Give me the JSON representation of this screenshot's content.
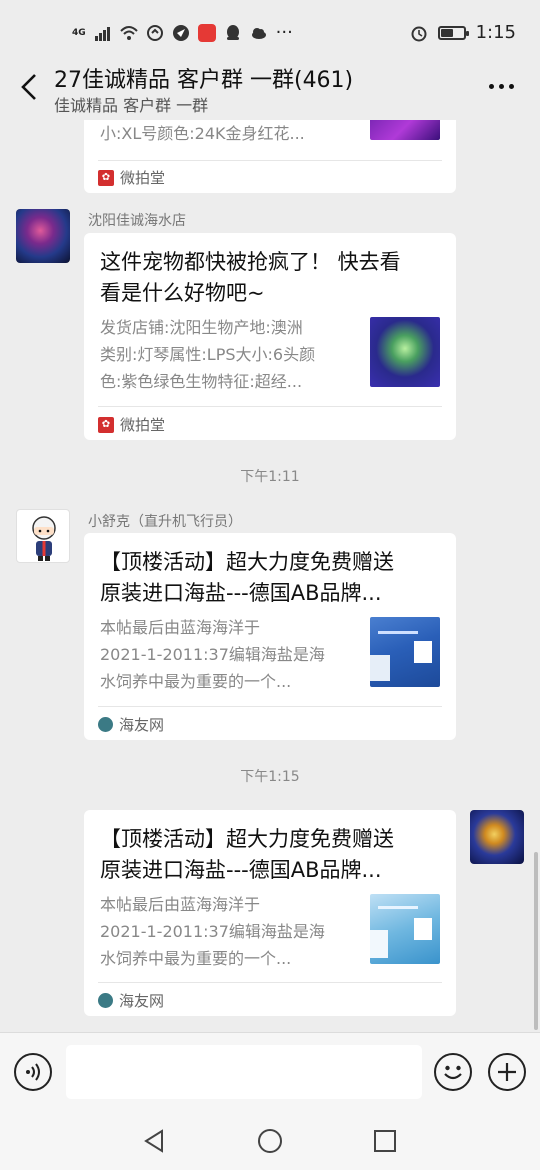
{
  "status_bar": {
    "network": "4G",
    "time": "1:15",
    "battery_level": 0.55
  },
  "header": {
    "title": "27佳诚精品 客户群 一群(461)",
    "subtitle": "佳诚精品 客户群 一群"
  },
  "messages": [
    {
      "type": "card",
      "direction": "in",
      "sender": "",
      "title": "",
      "desc_lines": [
        "小:XL号颜色:24K金身红花..."
      ],
      "source": "微拍堂"
    },
    {
      "type": "card",
      "direction": "in",
      "sender": "沈阳佳诚海水店",
      "title_lines": [
        "这件宠物都快被抢疯了！ 快去看",
        "看是什么好物吧~"
      ],
      "desc_lines": [
        "发货店铺:沈阳生物产地:澳洲",
        "类别:灯琴属性:LPS大小:6头颜",
        "色:紫色绿色生物特征:超经..."
      ],
      "source": "微拍堂"
    },
    {
      "type": "time",
      "text": "下午1:11"
    },
    {
      "type": "card",
      "direction": "in",
      "sender": "小舒克（直升机飞行员）",
      "title_lines": [
        "【顶楼活动】超大力度免费赠送",
        "原装进口海盐---德国AB品牌..."
      ],
      "desc_lines": [
        "本帖最后由蓝海海洋于",
        "2021-1-2011:37编辑海盐是海",
        "水饲养中最为重要的一个..."
      ],
      "source": "海友网"
    },
    {
      "type": "time",
      "text": "下午1:15"
    },
    {
      "type": "card",
      "direction": "out",
      "sender": "",
      "title_lines": [
        "【顶楼活动】超大力度免费赠送",
        "原装进口海盐---德国AB品牌..."
      ],
      "desc_lines": [
        "本帖最后由蓝海海洋于",
        "2021-1-2011:37编辑海盐是海",
        "水饲养中最为重要的一个..."
      ],
      "source": "海友网"
    }
  ],
  "input": {
    "value": "",
    "placeholder": ""
  },
  "icons": {
    "back": "back-arrow-icon",
    "more": "more-icon",
    "voice": "voice-icon",
    "emoji": "emoji-icon",
    "plus": "plus-icon",
    "nav_back": "nav-back-icon",
    "nav_home": "nav-home-icon",
    "nav_recent": "nav-recent-icon"
  },
  "colors": {
    "background": "#ededed",
    "card": "#ffffff",
    "wpt_red": "#d32f2f",
    "hy_teal": "#3b7a85"
  }
}
